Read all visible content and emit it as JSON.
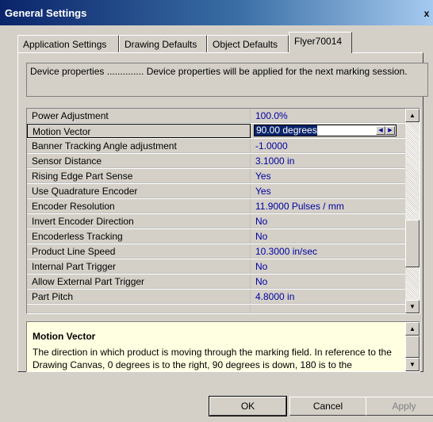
{
  "window": {
    "title": "General Settings",
    "close_label": "x"
  },
  "tabs": [
    {
      "label": "Application Settings"
    },
    {
      "label": "Drawing Defaults"
    },
    {
      "label": "Object Defaults"
    },
    {
      "label": "Flyer70014"
    }
  ],
  "description": "Device properties .............. Device properties will be applied for the next marking session.",
  "properties": [
    {
      "name": "Power Adjustment",
      "value": "100.0%"
    },
    {
      "name": "Motion Vector",
      "value": "90.00 degrees"
    },
    {
      "name": "Banner Tracking Angle adjustment",
      "value": "-1.0000"
    },
    {
      "name": "Sensor Distance",
      "value": "3.1000 in"
    },
    {
      "name": "Rising Edge Part Sense",
      "value": "Yes"
    },
    {
      "name": "Use Quadrature Encoder",
      "value": "Yes"
    },
    {
      "name": "Encoder Resolution",
      "value": "11.9000 Pulses / mm"
    },
    {
      "name": "Invert Encoder Direction",
      "value": "No"
    },
    {
      "name": "Encoderless Tracking",
      "value": "No"
    },
    {
      "name": "Product Line Speed",
      "value": "10.3000 in/sec"
    },
    {
      "name": "Internal Part Trigger",
      "value": "No"
    },
    {
      "name": "Allow External Part Trigger",
      "value": "No"
    },
    {
      "name": "Part Pitch",
      "value": "4.8000 in"
    }
  ],
  "help": {
    "title": "Motion Vector",
    "body": "The direction in which product is moving through the marking field. In reference to the Drawing Canvas, 0 degrees is to the right, 90 degrees is down, 180 is to the"
  },
  "buttons": {
    "ok": "OK",
    "cancel": "Cancel",
    "apply": "Apply"
  }
}
